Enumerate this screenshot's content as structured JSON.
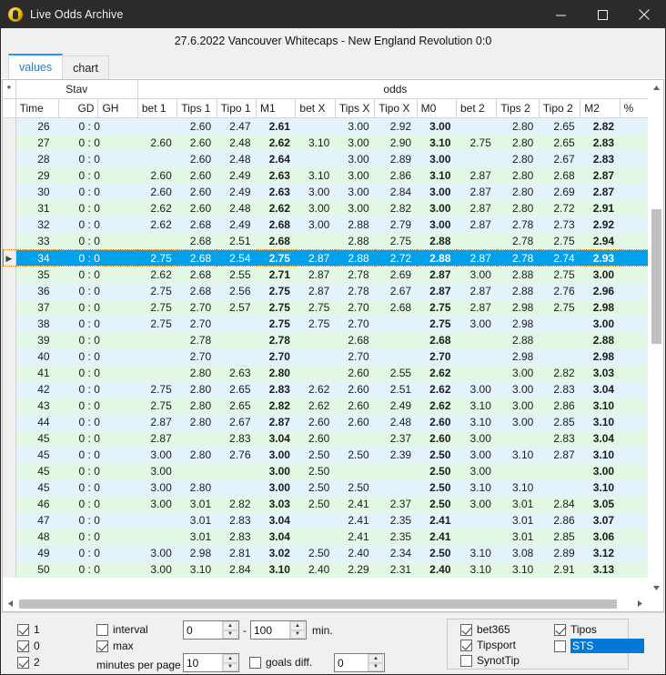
{
  "window": {
    "title": "Live Odds Archive",
    "icon": "trophy-icon",
    "minimize": "minimize-icon",
    "maximize": "maximize-icon",
    "close": "close-icon"
  },
  "match_header": "27.6.2022 Vancouver Whitecaps - New England Revolution  0:0",
  "tabs": [
    {
      "label": "values",
      "active": true
    },
    {
      "label": "chart",
      "active": false
    }
  ],
  "grid": {
    "group_headers": [
      {
        "label": "*",
        "span": 1
      },
      {
        "label": "Stav",
        "span": 3
      },
      {
        "label": "odds",
        "span": 13
      }
    ],
    "columns": [
      {
        "key": "sel",
        "label": "",
        "align": "center"
      },
      {
        "key": "time",
        "label": "Time",
        "align": "left"
      },
      {
        "key": "gd",
        "label": "GD",
        "align": "right"
      },
      {
        "key": "gh",
        "label": "GH",
        "align": "left"
      },
      {
        "key": "bet1",
        "label": "bet 1",
        "align": "left"
      },
      {
        "key": "tips1",
        "label": "Tips 1",
        "align": "left"
      },
      {
        "key": "tipo1",
        "label": "Tipo 1",
        "align": "left"
      },
      {
        "key": "m1",
        "label": "M1",
        "align": "left"
      },
      {
        "key": "betx",
        "label": "bet X",
        "align": "left"
      },
      {
        "key": "tipsx",
        "label": "Tips X",
        "align": "left"
      },
      {
        "key": "tipox",
        "label": "Tipo X",
        "align": "left"
      },
      {
        "key": "m0",
        "label": "M0",
        "align": "left"
      },
      {
        "key": "bet2",
        "label": "bet 2",
        "align": "left"
      },
      {
        "key": "tips2",
        "label": "Tips 2",
        "align": "left"
      },
      {
        "key": "tipo2",
        "label": "Tipo 2",
        "align": "left"
      },
      {
        "key": "m2",
        "label": "M2",
        "align": "left"
      },
      {
        "key": "pct",
        "label": "%",
        "align": "left"
      }
    ],
    "selected_row_index": 8,
    "rows": [
      {
        "time": "26",
        "score": "0 : 0",
        "bet1": "",
        "tips1": "2.60",
        "tipo1": "2.47",
        "m1": "2.61",
        "betx": "",
        "tipsx": "3.00",
        "tipox": "2.92",
        "m0": "3.00",
        "bet2": "",
        "tips2": "2.80",
        "tipo2": "2.65",
        "m2": "2.82",
        "pct": ""
      },
      {
        "time": "27",
        "score": "0 : 0",
        "bet1": "2.60",
        "tips1": "2.60",
        "tipo1": "2.48",
        "m1": "2.62",
        "betx": "3.10",
        "tipsx": "3.00",
        "tipox": "2.90",
        "m0": "3.10",
        "bet2": "2.75",
        "tips2": "2.80",
        "tipo2": "2.65",
        "m2": "2.83",
        "pct": ""
      },
      {
        "time": "28",
        "score": "0 : 0",
        "bet1": "",
        "tips1": "2.60",
        "tipo1": "2.48",
        "m1": "2.64",
        "betx": "",
        "tipsx": "3.00",
        "tipox": "2.89",
        "m0": "3.00",
        "bet2": "",
        "tips2": "2.80",
        "tipo2": "2.67",
        "m2": "2.83",
        "pct": ""
      },
      {
        "time": "29",
        "score": "0 : 0",
        "bet1": "2.60",
        "tips1": "2.60",
        "tipo1": "2.49",
        "m1": "2.63",
        "betx": "3.10",
        "tipsx": "3.00",
        "tipox": "2.86",
        "m0": "3.10",
        "bet2": "2.87",
        "tips2": "2.80",
        "tipo2": "2.68",
        "m2": "2.87",
        "pct": ""
      },
      {
        "time": "30",
        "score": "0 : 0",
        "bet1": "2.60",
        "tips1": "2.60",
        "tipo1": "2.49",
        "m1": "2.63",
        "betx": "3.00",
        "tipsx": "3.00",
        "tipox": "2.84",
        "m0": "3.00",
        "bet2": "2.87",
        "tips2": "2.80",
        "tipo2": "2.69",
        "m2": "2.87",
        "pct": ""
      },
      {
        "time": "31",
        "score": "0 : 0",
        "bet1": "2.62",
        "tips1": "2.60",
        "tipo1": "2.48",
        "m1": "2.62",
        "betx": "3.00",
        "tipsx": "3.00",
        "tipox": "2.82",
        "m0": "3.00",
        "bet2": "2.87",
        "tips2": "2.80",
        "tipo2": "2.72",
        "m2": "2.91",
        "pct": ""
      },
      {
        "time": "32",
        "score": "0 : 0",
        "bet1": "2.62",
        "tips1": "2.68",
        "tipo1": "2.49",
        "m1": "2.68",
        "betx": "3.00",
        "tipsx": "2.88",
        "tipox": "2.79",
        "m0": "3.00",
        "bet2": "2.87",
        "tips2": "2.78",
        "tipo2": "2.73",
        "m2": "2.92",
        "pct": ""
      },
      {
        "time": "33",
        "score": "0 : 0",
        "bet1": "",
        "tips1": "2.68",
        "tipo1": "2.51",
        "m1": "2.68",
        "betx": "",
        "tipsx": "2.88",
        "tipox": "2.75",
        "m0": "2.88",
        "bet2": "",
        "tips2": "2.78",
        "tipo2": "2.75",
        "m2": "2.94",
        "pct": ""
      },
      {
        "time": "34",
        "score": "0 : 0",
        "bet1": "2.75",
        "tips1": "2.68",
        "tipo1": "2.54",
        "m1": "2.75",
        "betx": "2.87",
        "tipsx": "2.88",
        "tipox": "2.72",
        "m0": "2.88",
        "bet2": "2.87",
        "tips2": "2.78",
        "tipo2": "2.74",
        "m2": "2.93",
        "pct": ""
      },
      {
        "time": "35",
        "score": "0 : 0",
        "bet1": "2.62",
        "tips1": "2.68",
        "tipo1": "2.55",
        "m1": "2.71",
        "betx": "2.87",
        "tipsx": "2.78",
        "tipox": "2.69",
        "m0": "2.87",
        "bet2": "3.00",
        "tips2": "2.88",
        "tipo2": "2.75",
        "m2": "3.00",
        "pct": ""
      },
      {
        "time": "36",
        "score": "0 : 0",
        "bet1": "2.75",
        "tips1": "2.68",
        "tipo1": "2.56",
        "m1": "2.75",
        "betx": "2.87",
        "tipsx": "2.78",
        "tipox": "2.67",
        "m0": "2.87",
        "bet2": "2.87",
        "tips2": "2.88",
        "tipo2": "2.76",
        "m2": "2.96",
        "pct": ""
      },
      {
        "time": "37",
        "score": "0 : 0",
        "bet1": "2.75",
        "tips1": "2.70",
        "tipo1": "2.57",
        "m1": "2.75",
        "betx": "2.75",
        "tipsx": "2.70",
        "tipox": "2.68",
        "m0": "2.75",
        "bet2": "2.87",
        "tips2": "2.98",
        "tipo2": "2.75",
        "m2": "2.98",
        "pct": ""
      },
      {
        "time": "38",
        "score": "0 : 0",
        "bet1": "2.75",
        "tips1": "2.70",
        "tipo1": "",
        "m1": "2.75",
        "betx": "2.75",
        "tipsx": "2.70",
        "tipox": "",
        "m0": "2.75",
        "bet2": "3.00",
        "tips2": "2.98",
        "tipo2": "",
        "m2": "3.00",
        "pct": ""
      },
      {
        "time": "39",
        "score": "0 : 0",
        "bet1": "",
        "tips1": "2.78",
        "tipo1": "",
        "m1": "2.78",
        "betx": "",
        "tipsx": "2.68",
        "tipox": "",
        "m0": "2.68",
        "bet2": "",
        "tips2": "2.88",
        "tipo2": "",
        "m2": "2.88",
        "pct": ""
      },
      {
        "time": "40",
        "score": "0 : 0",
        "bet1": "",
        "tips1": "2.70",
        "tipo1": "",
        "m1": "2.70",
        "betx": "",
        "tipsx": "2.70",
        "tipox": "",
        "m0": "2.70",
        "bet2": "",
        "tips2": "2.98",
        "tipo2": "",
        "m2": "2.98",
        "pct": ""
      },
      {
        "time": "41",
        "score": "0 : 0",
        "bet1": "",
        "tips1": "2.80",
        "tipo1": "2.63",
        "m1": "2.80",
        "betx": "",
        "tipsx": "2.60",
        "tipox": "2.55",
        "m0": "2.62",
        "bet2": "",
        "tips2": "3.00",
        "tipo2": "2.82",
        "m2": "3.03",
        "pct": ""
      },
      {
        "time": "42",
        "score": "0 : 0",
        "bet1": "2.75",
        "tips1": "2.80",
        "tipo1": "2.65",
        "m1": "2.83",
        "betx": "2.62",
        "tipsx": "2.60",
        "tipox": "2.51",
        "m0": "2.62",
        "bet2": "3.00",
        "tips2": "3.00",
        "tipo2": "2.83",
        "m2": "3.04",
        "pct": ""
      },
      {
        "time": "43",
        "score": "0 : 0",
        "bet1": "2.75",
        "tips1": "2.80",
        "tipo1": "2.65",
        "m1": "2.82",
        "betx": "2.62",
        "tipsx": "2.60",
        "tipox": "2.49",
        "m0": "2.62",
        "bet2": "3.10",
        "tips2": "3.00",
        "tipo2": "2.86",
        "m2": "3.10",
        "pct": ""
      },
      {
        "time": "44",
        "score": "0 : 0",
        "bet1": "2.87",
        "tips1": "2.80",
        "tipo1": "2.67",
        "m1": "2.87",
        "betx": "2.60",
        "tipsx": "2.60",
        "tipox": "2.48",
        "m0": "2.60",
        "bet2": "3.10",
        "tips2": "3.00",
        "tipo2": "2.85",
        "m2": "3.10",
        "pct": ""
      },
      {
        "time": "45",
        "score": "0 : 0",
        "bet1": "2.87",
        "tips1": "",
        "tipo1": "2.83",
        "m1": "3.04",
        "betx": "2.60",
        "tipsx": "",
        "tipox": "2.37",
        "m0": "2.60",
        "bet2": "3.00",
        "tips2": "",
        "tipo2": "2.83",
        "m2": "3.04",
        "pct": ""
      },
      {
        "time": "45",
        "score": "0 : 0",
        "bet1": "3.00",
        "tips1": "2.80",
        "tipo1": "2.76",
        "m1": "3.00",
        "betx": "2.50",
        "tipsx": "2.50",
        "tipox": "2.39",
        "m0": "2.50",
        "bet2": "3.00",
        "tips2": "3.10",
        "tipo2": "2.87",
        "m2": "3.10",
        "pct": ""
      },
      {
        "time": "45",
        "score": "0 : 0",
        "bet1": "3.00",
        "tips1": "",
        "tipo1": "",
        "m1": "3.00",
        "betx": "2.50",
        "tipsx": "",
        "tipox": "",
        "m0": "2.50",
        "bet2": "3.00",
        "tips2": "",
        "tipo2": "",
        "m2": "3.00",
        "pct": ""
      },
      {
        "time": "45",
        "score": "0 : 0",
        "bet1": "3.00",
        "tips1": "2.80",
        "tipo1": "",
        "m1": "3.00",
        "betx": "2.50",
        "tipsx": "2.50",
        "tipox": "",
        "m0": "2.50",
        "bet2": "3.10",
        "tips2": "3.10",
        "tipo2": "",
        "m2": "3.10",
        "pct": ""
      },
      {
        "time": "46",
        "score": "0 : 0",
        "bet1": "3.00",
        "tips1": "3.01",
        "tipo1": "2.82",
        "m1": "3.03",
        "betx": "2.50",
        "tipsx": "2.41",
        "tipox": "2.37",
        "m0": "2.50",
        "bet2": "3.00",
        "tips2": "3.01",
        "tipo2": "2.84",
        "m2": "3.05",
        "pct": ""
      },
      {
        "time": "47",
        "score": "0 : 0",
        "bet1": "",
        "tips1": "3.01",
        "tipo1": "2.83",
        "m1": "3.04",
        "betx": "",
        "tipsx": "2.41",
        "tipox": "2.35",
        "m0": "2.41",
        "bet2": "",
        "tips2": "3.01",
        "tipo2": "2.86",
        "m2": "3.07",
        "pct": ""
      },
      {
        "time": "48",
        "score": "0 : 0",
        "bet1": "",
        "tips1": "3.01",
        "tipo1": "2.83",
        "m1": "3.04",
        "betx": "",
        "tipsx": "2.41",
        "tipox": "2.35",
        "m0": "2.41",
        "bet2": "",
        "tips2": "3.01",
        "tipo2": "2.85",
        "m2": "3.06",
        "pct": ""
      },
      {
        "time": "49",
        "score": "0 : 0",
        "bet1": "3.00",
        "tips1": "2.98",
        "tipo1": "2.81",
        "m1": "3.02",
        "betx": "2.50",
        "tipsx": "2.40",
        "tipox": "2.34",
        "m0": "2.50",
        "bet2": "3.10",
        "tips2": "3.08",
        "tipo2": "2.89",
        "m2": "3.12",
        "pct": ""
      },
      {
        "time": "50",
        "score": "0 : 0",
        "bet1": "3.00",
        "tips1": "3.10",
        "tipo1": "2.84",
        "m1": "3.10",
        "betx": "2.40",
        "tipsx": "2.29",
        "tipox": "2.31",
        "m0": "2.40",
        "bet2": "3.10",
        "tips2": "3.10",
        "tipo2": "2.91",
        "m2": "3.13",
        "pct": ""
      }
    ]
  },
  "bottom": {
    "score_filters": [
      {
        "label": "1",
        "checked": true
      },
      {
        "label": "0",
        "checked": true
      },
      {
        "label": "2",
        "checked": true
      }
    ],
    "interval": {
      "label": "interval",
      "checked": false
    },
    "max": {
      "label": "max",
      "checked": true
    },
    "range_from": "0",
    "range_dash": "-",
    "range_to": "100",
    "range_unit": "min.",
    "minutes_per_page_label": "minutes per page",
    "minutes_per_page": "10",
    "goals_diff": {
      "label": "goals diff.",
      "checked": false
    },
    "goals_diff_value": "0",
    "bookmakers": [
      {
        "label": "bet365",
        "checked": true,
        "selected": false
      },
      {
        "label": "Tipsport",
        "checked": true,
        "selected": false
      },
      {
        "label": "SynotTip",
        "checked": false,
        "selected": false
      },
      {
        "label": "Tipos",
        "checked": true,
        "selected": false
      },
      {
        "label": "STS",
        "checked": false,
        "selected": true
      }
    ]
  },
  "colors": {
    "selection_blue": "#00a0ea",
    "focus_orange": "#e07b12",
    "row_odd": "#e3f2fb",
    "row_even": "#e2f7e4",
    "titlebar": "#2b2b2b",
    "accent_tab": "#1a9bf0",
    "listbox_selection": "#0078d7"
  }
}
